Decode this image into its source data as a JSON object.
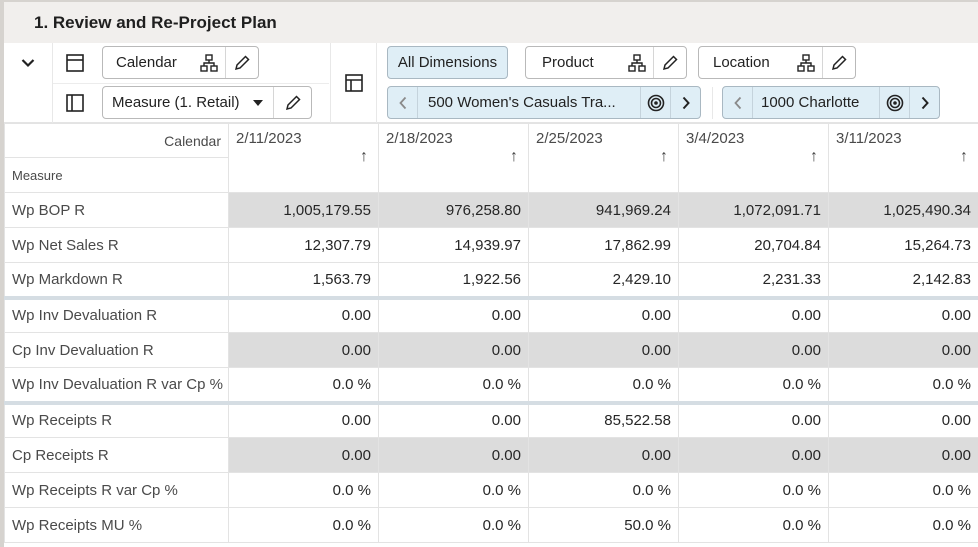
{
  "title": "1. Review and Re-Project Plan",
  "toolbar": {
    "calendar_label": "Calendar",
    "measure_label": "Measure (1. Retail)",
    "all_dimensions_label": "All Dimensions",
    "product_label": "Product",
    "location_label": "Location",
    "product_value": "500 Women's Casuals Tra...",
    "location_value": "1000 Charlotte"
  },
  "grid": {
    "corner_calendar": "Calendar",
    "corner_measure": "Measure",
    "columns": [
      "2/11/2023",
      "2/18/2023",
      "2/25/2023",
      "3/4/2023",
      "3/11/2023"
    ],
    "sort_arrow": "↑",
    "rows": [
      {
        "label": "Wp BOP R",
        "readonly": true,
        "group_start": false,
        "values": [
          "1,005,179.55",
          "976,258.80",
          "941,969.24",
          "1,072,091.71",
          "1,025,490.34"
        ]
      },
      {
        "label": "Wp Net Sales R",
        "readonly": false,
        "group_start": false,
        "values": [
          "12,307.79",
          "14,939.97",
          "17,862.99",
          "20,704.84",
          "15,264.73"
        ]
      },
      {
        "label": "Wp Markdown R",
        "readonly": false,
        "group_start": false,
        "values": [
          "1,563.79",
          "1,922.56",
          "2,429.10",
          "2,231.33",
          "2,142.83"
        ]
      },
      {
        "label": "Wp Inv Devaluation R",
        "readonly": false,
        "group_start": true,
        "values": [
          "0.00",
          "0.00",
          "0.00",
          "0.00",
          "0.00"
        ]
      },
      {
        "label": "Cp Inv Devaluation R",
        "readonly": true,
        "group_start": false,
        "values": [
          "0.00",
          "0.00",
          "0.00",
          "0.00",
          "0.00"
        ]
      },
      {
        "label": "Wp Inv Devaluation R var Cp %",
        "readonly": false,
        "group_start": false,
        "values": [
          "0.0 %",
          "0.0 %",
          "0.0 %",
          "0.0 %",
          "0.0 %"
        ]
      },
      {
        "label": "Wp Receipts R",
        "readonly": false,
        "group_start": true,
        "values": [
          "0.00",
          "0.00",
          "85,522.58",
          "0.00",
          "0.00"
        ]
      },
      {
        "label": "Cp Receipts R",
        "readonly": true,
        "group_start": false,
        "values": [
          "0.00",
          "0.00",
          "0.00",
          "0.00",
          "0.00"
        ]
      },
      {
        "label": "Wp Receipts R var Cp %",
        "readonly": false,
        "group_start": false,
        "values": [
          "0.0 %",
          "0.0 %",
          "0.0 %",
          "0.0 %",
          "0.0 %"
        ]
      },
      {
        "label": "Wp Receipts MU %",
        "readonly": false,
        "group_start": false,
        "values": [
          "0.0 %",
          "0.0 %",
          "50.0 %",
          "0.0 %",
          "0.0 %"
        ]
      }
    ]
  }
}
